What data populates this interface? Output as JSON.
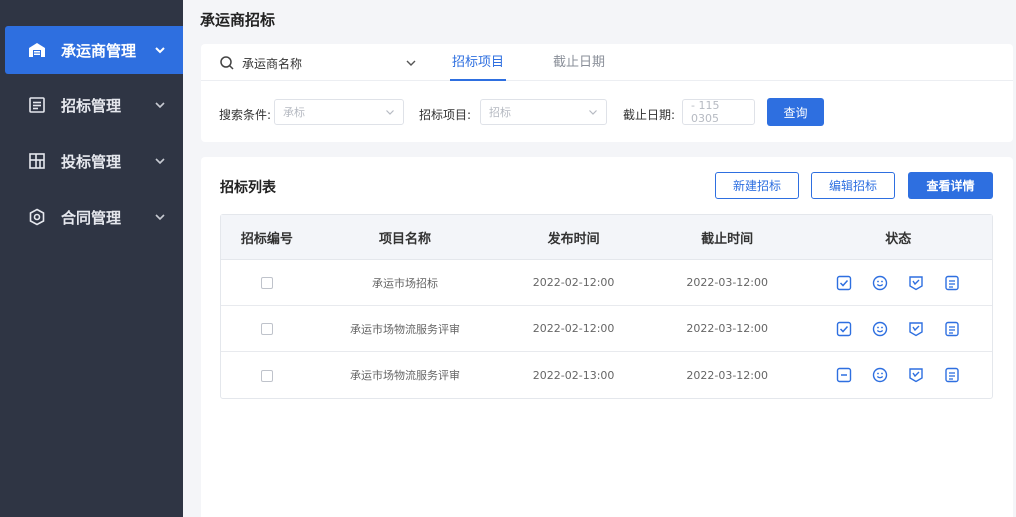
{
  "page": {
    "title": "承运商招标"
  },
  "sidebar": {
    "items": [
      {
        "label": "承运商管理",
        "icon": "warehouse-icon",
        "active": true
      },
      {
        "label": "招标管理",
        "icon": "document-icon",
        "active": false
      },
      {
        "label": "投标管理",
        "icon": "grid-icon",
        "active": false
      },
      {
        "label": "合同管理",
        "icon": "hexagon-icon",
        "active": false
      }
    ]
  },
  "filter": {
    "search_value": "承运商名称",
    "tabs": [
      {
        "label": "招标项目",
        "active": true
      },
      {
        "label": "截止日期",
        "active": false
      }
    ],
    "fields": [
      {
        "label": "搜索条件:",
        "value": "承标"
      },
      {
        "label": "招标项目:",
        "value": "招标"
      },
      {
        "label": "截止日期:",
        "value": "- 115 0305"
      }
    ],
    "query_label": "查询"
  },
  "list": {
    "title": "招标列表",
    "buttons": {
      "new": "新建招标",
      "edit": "编辑招标",
      "detail": "查看详情"
    },
    "columns": [
      "招标编号",
      "项目名称",
      "发布时间",
      "截止时间",
      "状态"
    ],
    "rows": [
      {
        "name": "承运市场招标",
        "publish": "2022-02-12:00",
        "deadline": "2022-03-12:00",
        "status_icons": [
          "check-doc-icon",
          "smile-icon",
          "badge-icon",
          "list-doc-icon"
        ]
      },
      {
        "name": "承运市场物流服务评审",
        "publish": "2022-02-12:00",
        "deadline": "2022-03-12:00",
        "status_icons": [
          "check-doc-icon",
          "smile-icon",
          "badge-icon",
          "list-doc-icon"
        ]
      },
      {
        "name": "承运市场物流服务评审",
        "publish": "2022-02-13:00",
        "deadline": "2022-03-12:00",
        "status_icons": [
          "minus-doc-icon",
          "smile-icon",
          "badge-icon",
          "list-doc-icon"
        ]
      }
    ]
  },
  "colors": {
    "accent": "#2e6fe0",
    "sidebar_bg": "#2f3544",
    "page_bg": "#f4f5f8"
  }
}
